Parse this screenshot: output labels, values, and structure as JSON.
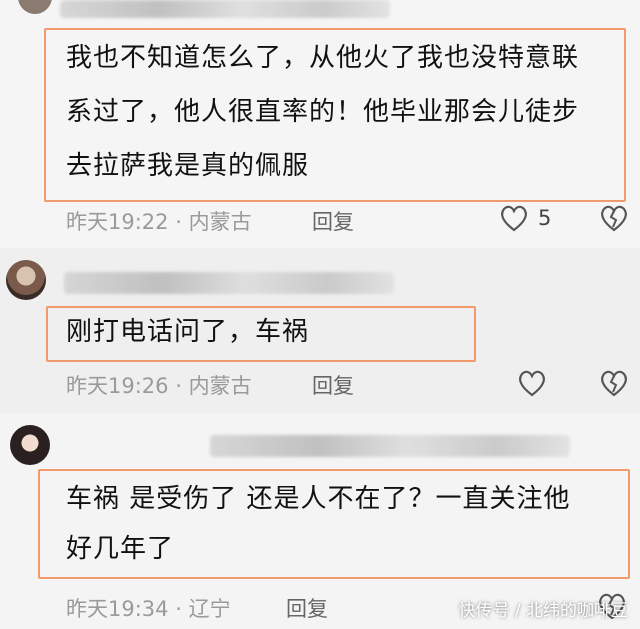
{
  "comments": [
    {
      "text_lines": [
        "我也不知道怎么了，从他火了我也没特意联",
        "系过了，他人很直率的！他毕业那会儿徒步",
        "去拉萨我是真的佩服"
      ],
      "time": "昨天19:22",
      "location": "内蒙古",
      "reply_label": "回复",
      "like_count": "5"
    },
    {
      "text_lines": [
        "刚打电话问了，车祸"
      ],
      "time": "昨天19:26",
      "location": "内蒙古",
      "reply_label": "回复"
    },
    {
      "text_lines": [
        "车祸 是受伤了 还是人不在了？一直关注他",
        "好几年了"
      ],
      "time": "昨天19:34",
      "location": "辽宁",
      "reply_label": "回复"
    }
  ],
  "separator": "·",
  "watermark": "快传号 / 北纬的咖啡豆",
  "colors": {
    "highlight_border": "#f39a6c",
    "meta_text": "#9a9a9a",
    "background": "#f3f3f3"
  },
  "icons": {
    "like": "heart-outline-icon",
    "dislike": "broken-heart-icon"
  }
}
